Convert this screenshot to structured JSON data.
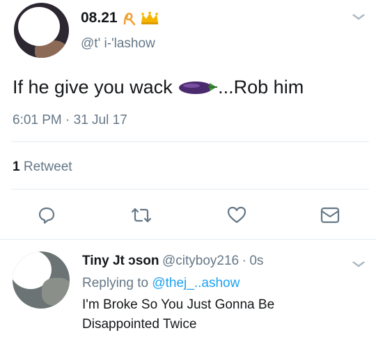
{
  "tweet": {
    "display_name": "08.21",
    "badge_icons": [
      "ribbon-icon",
      "crown-icon"
    ],
    "handle": "@t'  i-'lashow",
    "text": "If he give you wack",
    "emoji_icon": "eggplant-icon",
    "text_suffix": "...Rob him",
    "timestamp": "6:01 PM · 31 Jul 17",
    "retweet_count": "1",
    "retweet_label": "Retweet"
  },
  "actions": [
    "reply-icon",
    "retweet-icon",
    "like-icon",
    "message-icon"
  ],
  "reply": {
    "display_name": "Tiny Jt   ɔson",
    "handle": "@cityboy216",
    "separator": "·",
    "time": "0s",
    "replying_to_prefix": "Replying to",
    "replying_to_handle": "@thej_..ashow",
    "text_line1": "I'm Broke So You Just Gonna Be",
    "text_line2": "Disappointed Twice"
  },
  "colors": {
    "text": "#14171a",
    "secondary": "#657786",
    "link": "#1da1f2",
    "icon": "#657786",
    "divider": "#e6ecf0"
  }
}
